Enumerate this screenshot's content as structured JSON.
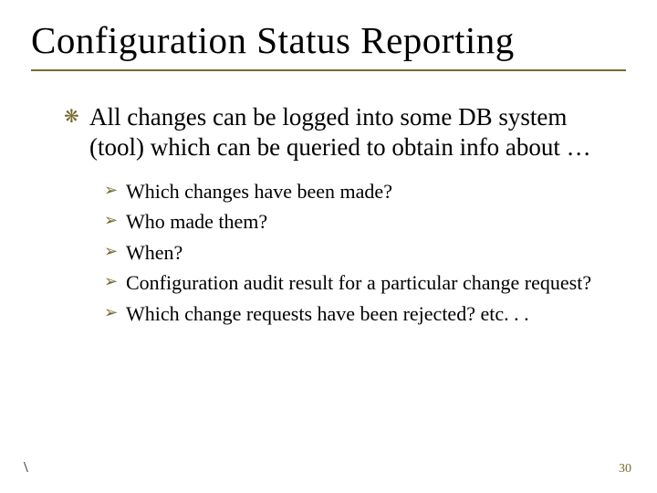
{
  "title": "Configuration Status Reporting",
  "main_bullet_glyph": "❋",
  "main_text": "All changes can be logged into some DB system (tool) which can be queried to obtain info about …",
  "sub_bullet_glyph": "➢",
  "sub_items": {
    "0": "Which changes have been made?",
    "1": "Who made them?",
    "2": "When?",
    "3": "Configuration audit result for a particular change request?",
    "4": "Which change requests have been rejected? etc. . ."
  },
  "footer": {
    "left": "\\",
    "pagenum": "30"
  },
  "colors": {
    "accent": "#766b2f"
  }
}
